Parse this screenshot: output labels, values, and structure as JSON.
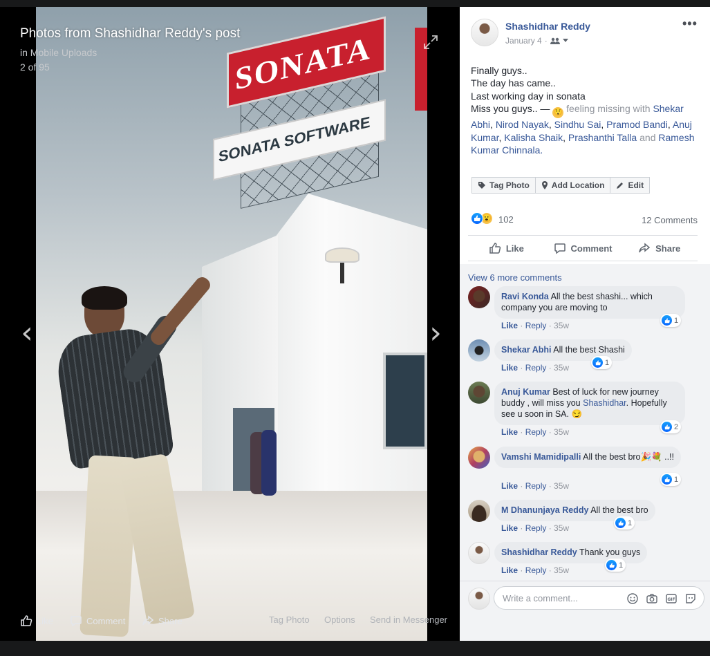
{
  "photo": {
    "title": "Photos from Shashidhar Reddy's post",
    "album": "in Mobile Uploads",
    "count": "2 of 95",
    "sign_text_main": "SONATA",
    "sign_text_sub": "SONATA SOFTWARE",
    "bar": {
      "like": "Like",
      "comment": "Comment",
      "share": "Share",
      "tag_photo": "Tag Photo",
      "options": "Options",
      "send": "Send in Messenger"
    }
  },
  "post": {
    "author": "Shashidhar Reddy",
    "date": "January 4",
    "text_lines": [
      "Finally guys..",
      "The day has came..",
      "Last working day in sonata"
    ],
    "text_miss": "Miss you guys.. —",
    "feeling": " feeling missing with ",
    "tagged": [
      "Shekar Abhi",
      "Nirod Nayak",
      "Sindhu Sai",
      "Pramod Bandi",
      "Anuj Kumar",
      "Kalisha Shaik",
      "Prashanthi Talla"
    ],
    "and_word": "and",
    "tagged_last": "Ramesh Kumar Chinnala",
    "buttons": {
      "tag_photo": "Tag Photo",
      "add_location": "Add Location",
      "edit": "Edit"
    },
    "reaction_count": "102",
    "comments_count": "12 Comments",
    "actions": {
      "like": "Like",
      "comment": "Comment",
      "share": "Share"
    }
  },
  "comments": {
    "view_more": "View 6 more comments",
    "like_label": "Like",
    "reply_label": "Reply",
    "items": [
      {
        "name": "Ravi Konda",
        "text": "All the best shashi... which company you are moving to",
        "time": "35w",
        "likes": "1"
      },
      {
        "name": "Shekar Abhi",
        "text": "All the best Shashi",
        "time": "35w",
        "likes": "1"
      },
      {
        "name": "Anuj Kumar",
        "text": "Best of luck for new journey buddy , will miss you ",
        "mention": "Shashidhar",
        "text_after": ". Hopefully see u soon in SA. 😏",
        "time": "35w",
        "likes": "2"
      },
      {
        "name": "Vamshi Mamidipalli",
        "text": "All the best bro🎉💐 ..!!",
        "time": "35w",
        "likes": "1"
      },
      {
        "name": "M Dhanunjaya Reddy",
        "text": "All the best bro",
        "time": "35w",
        "likes": "1"
      },
      {
        "name": "Shashidhar Reddy",
        "text": "Thank you guys",
        "time": "35w",
        "likes": "1"
      }
    ]
  },
  "composer": {
    "placeholder": "Write a comment..."
  },
  "colors": {
    "link": "#385898",
    "like_blue": "#0866ff",
    "sign_red": "#c8202e"
  }
}
